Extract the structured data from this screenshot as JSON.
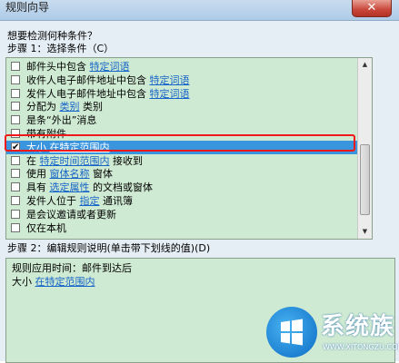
{
  "window": {
    "title": "规则向导",
    "close_label": "✕"
  },
  "prompt": "想要检测何种条件？",
  "step1_label": "步骤 1：选择条件（C）",
  "conditions": [
    {
      "parts": [
        "邮件头中包含 ",
        {
          "link": "特定词语"
        }
      ],
      "checked": false
    },
    {
      "parts": [
        "收件人电子邮件地址中包含 ",
        {
          "link": "特定词语"
        }
      ],
      "checked": false
    },
    {
      "parts": [
        "发件人电子邮件地址中包含 ",
        {
          "link": "特定词语"
        }
      ],
      "checked": false
    },
    {
      "parts": [
        "分配为 ",
        {
          "link": "类别"
        },
        " 类别"
      ],
      "checked": false
    },
    {
      "parts": [
        "是条“外出”消息"
      ],
      "checked": false
    },
    {
      "parts": [
        "带有附件"
      ],
      "checked": false
    },
    {
      "parts": [
        "大小 ",
        {
          "link": "在特定范围内"
        }
      ],
      "checked": true,
      "selected": true
    },
    {
      "parts": [
        "在 ",
        {
          "link": "特定时间范围内"
        },
        " 接收到"
      ],
      "checked": false
    },
    {
      "parts": [
        "使用 ",
        {
          "link": "窗体名称"
        },
        " 窗体"
      ],
      "checked": false
    },
    {
      "parts": [
        "具有 ",
        {
          "link": "选定属性"
        },
        " 的文档或窗体"
      ],
      "checked": false
    },
    {
      "parts": [
        "发件人位于 ",
        {
          "link": "指定"
        },
        " 通讯簿"
      ],
      "checked": false
    },
    {
      "parts": [
        "是会议邀请或者更新"
      ],
      "checked": false
    },
    {
      "parts": [
        "仅在本机"
      ],
      "checked": false
    }
  ],
  "check_mark": "✔",
  "step2_label": "步骤 2：编辑规则说明(单击带下划线的值)(D)",
  "description": {
    "line1": "规则应用时间：邮件到达后",
    "line2_prefix": "大小 ",
    "line2_link": "在特定范围内"
  },
  "watermark": {
    "brand": "系统族",
    "url": "WWW.XITONGZU.COM"
  },
  "scroll_up": "▲",
  "scroll_down": "▼"
}
